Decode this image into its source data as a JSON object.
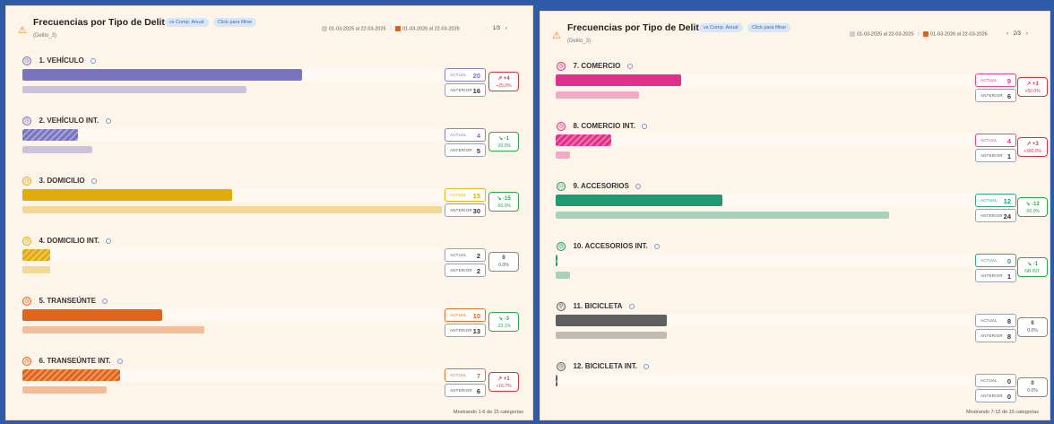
{
  "panels": [
    {
      "title": "Frecuencias por Tipo de Delito",
      "subtitle": "(Delito_3)",
      "chip_comp": "vs Comp. Anual",
      "chip_filter": "Click para filtrar",
      "legend_prev": "01-03-2025 al 22-03-2025",
      "legend_curr": "01-03-2026 al 22-03-2026",
      "legend_prev_color": "#cfcfcf",
      "legend_curr_color": "#e0601a",
      "page": "1/3",
      "footer": "Mostrando 1-6 de 15 categorías",
      "categories": [
        {
          "label": "1. VEHÍCULO",
          "icon": "clock-icon",
          "color": "#7a74c0",
          "hatched": false,
          "actual": 20,
          "anterior": 16,
          "delta": "↗ +4",
          "pct": "+25.0%",
          "trend": "up"
        },
        {
          "label": "2. VEHÍCULO INT.",
          "icon": "clock-icon",
          "color": "#7a74c0",
          "hatched": true,
          "actual": 4,
          "anterior": 5,
          "delta": "↘ -1",
          "pct": "-20.0%",
          "trend": "down"
        },
        {
          "label": "3. DOMICILIO",
          "icon": "clock-icon",
          "color": "#e3aa0c",
          "hatched": false,
          "actual": 15,
          "anterior": 30,
          "delta": "↘ -15",
          "pct": "-50.0%",
          "trend": "down"
        },
        {
          "label": "4. DOMICILIO INT.",
          "icon": "clock-icon",
          "color": "#e3aa0c",
          "hatched": true,
          "actual": 2,
          "anterior": 2,
          "delta": "0",
          "pct": "0.0%",
          "trend": "flat"
        },
        {
          "label": "5. TRANSEÚNTE",
          "icon": "clock-icon",
          "color": "#e0641a",
          "hatched": false,
          "actual": 10,
          "anterior": 13,
          "delta": "↘ -3",
          "pct": "-23.1%",
          "trend": "down"
        },
        {
          "label": "6. TRANSEÚNTE INT.",
          "icon": "clock-icon",
          "color": "#e0641a",
          "hatched": true,
          "actual": 7,
          "anterior": 6,
          "delta": "↗ +1",
          "pct": "+16.7%",
          "trend": "up"
        }
      ]
    },
    {
      "title": "Frecuencias por Tipo de Delito",
      "subtitle": "(Delito_3)",
      "chip_comp": "vs Comp. Anual",
      "chip_filter": "Click para filtrar",
      "legend_prev": "01-03-2025 al 22-03-2025",
      "legend_curr": "01-03-2026 al 22-03-2026",
      "legend_prev_color": "#cfcfcf",
      "legend_curr_color": "#e0601a",
      "page": "2/3",
      "footer": "Mostrando 7-12 de 15 categorías",
      "categories": [
        {
          "label": "7. COMERCIO",
          "icon": "clock-icon",
          "color": "#e0308a",
          "hatched": false,
          "actual": 9,
          "anterior": 6,
          "delta": "↗ +3",
          "pct": "+50.0%",
          "trend": "up"
        },
        {
          "label": "8. COMERCIO INT.",
          "icon": "clock-icon",
          "color": "#e0308a",
          "hatched": true,
          "actual": 4,
          "anterior": 1,
          "delta": "↗ +3",
          "pct": "+300.0%",
          "trend": "up"
        },
        {
          "label": "9. ACCESORIOS",
          "icon": "bag-icon",
          "color": "#1f9a72",
          "hatched": false,
          "actual": 12,
          "anterior": 24,
          "delta": "↘ -12",
          "pct": "-50.0%",
          "trend": "down"
        },
        {
          "label": "10. ACCESORIOS INT.",
          "icon": "clock-icon",
          "color": "#1f9a72",
          "hatched": true,
          "actual": 0,
          "anterior": 1,
          "delta": "↘ -1",
          "pct": "NR INT.",
          "trend": "down"
        },
        {
          "label": "11. BICICLETA",
          "icon": "bicycle-icon",
          "color": "#5f5f5f",
          "hatched": false,
          "actual": 8,
          "anterior": 8,
          "delta": "0",
          "pct": "0.0%",
          "trend": "flat"
        },
        {
          "label": "12. BICICLETA INT.",
          "icon": "clock-icon",
          "color": "#5f5f5f",
          "hatched": true,
          "actual": 0,
          "anterior": 0,
          "delta": "0",
          "pct": "0.0%",
          "trend": "flat"
        }
      ]
    }
  ],
  "labels": {
    "actual": "ACTUAL",
    "anterior": "ANTERIOR"
  },
  "trend_colors": {
    "up": "#e03040",
    "down": "#2aa84a",
    "flat": "#888888"
  }
}
